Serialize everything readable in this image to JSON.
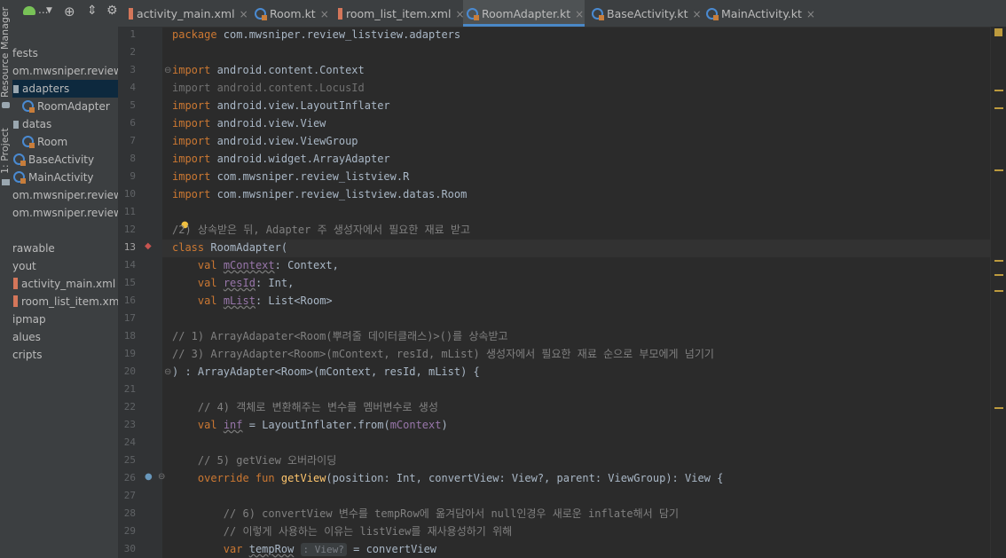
{
  "side_strip": {
    "resource_manager_label": "Resource Manager",
    "project_label": "1: Project"
  },
  "tree": [
    {
      "label": "fests",
      "indent": 0,
      "icon": "none"
    },
    {
      "label": "om.mwsniper.review_li",
      "indent": 0,
      "icon": "none"
    },
    {
      "label": "adapters",
      "indent": 1,
      "icon": "folder",
      "selected": true
    },
    {
      "label": "RoomAdapter",
      "indent": 2,
      "icon": "kotlin"
    },
    {
      "label": "datas",
      "indent": 1,
      "icon": "folder"
    },
    {
      "label": "Room",
      "indent": 2,
      "icon": "kotlin"
    },
    {
      "label": "BaseActivity",
      "indent": 1,
      "icon": "kotlin"
    },
    {
      "label": "MainActivity",
      "indent": 1,
      "icon": "kotlin"
    },
    {
      "label": "om.mwsniper.review_li",
      "indent": 0,
      "icon": "none"
    },
    {
      "label": "om.mwsniper.review_li",
      "indent": 0,
      "icon": "none"
    },
    {
      "label": "",
      "indent": 0,
      "icon": "none"
    },
    {
      "label": "rawable",
      "indent": 0,
      "icon": "none"
    },
    {
      "label": "yout",
      "indent": 0,
      "icon": "none"
    },
    {
      "label": "activity_main.xml",
      "indent": 1,
      "icon": "xml"
    },
    {
      "label": "room_list_item.xml",
      "indent": 1,
      "icon": "xml"
    },
    {
      "label": "ipmap",
      "indent": 0,
      "icon": "none"
    },
    {
      "label": "alues",
      "indent": 0,
      "icon": "none"
    },
    {
      "label": "cripts",
      "indent": 0,
      "icon": "none"
    }
  ],
  "tabs": [
    {
      "label": "activity_main.xml",
      "icon": "xml",
      "active": false
    },
    {
      "label": "Room.kt",
      "icon": "kotlin",
      "active": false
    },
    {
      "label": "room_list_item.xml",
      "icon": "xml",
      "active": false
    },
    {
      "label": "RoomAdapter.kt",
      "icon": "kotlin",
      "active": true
    },
    {
      "label": "BaseActivity.kt",
      "icon": "kotlin",
      "active": false
    },
    {
      "label": "MainActivity.kt",
      "icon": "kotlin",
      "active": false
    }
  ],
  "toolbar_dropdown_label": "...",
  "current_line": 13,
  "code_lines": [
    {
      "n": "1",
      "t": "package com.mwsniper.review_listview.adapters"
    },
    {
      "n": "2",
      "t": ""
    },
    {
      "n": "3",
      "t": "import android.content.Context"
    },
    {
      "n": "4",
      "t": "import android.content.LocusId"
    },
    {
      "n": "5",
      "t": "import android.view.LayoutInflater"
    },
    {
      "n": "6",
      "t": "import android.view.View"
    },
    {
      "n": "7",
      "t": "import android.view.ViewGroup"
    },
    {
      "n": "8",
      "t": "import android.widget.ArrayAdapter"
    },
    {
      "n": "9",
      "t": "import com.mwsniper.review_listview.R"
    },
    {
      "n": "10",
      "t": "import com.mwsniper.review_listview.datas.Room"
    },
    {
      "n": "11",
      "t": ""
    },
    {
      "n": "12",
      "t": "/2) 상속받은 뒤, Adapter 주 생성자에서 필요한 재료 받고"
    },
    {
      "n": "13",
      "t": "class RoomAdapter("
    },
    {
      "n": "14",
      "t": "    val mContext: Context,"
    },
    {
      "n": "15",
      "t": "    val resId: Int,"
    },
    {
      "n": "16",
      "t": "    val mList: List<Room>"
    },
    {
      "n": "17",
      "t": ""
    },
    {
      "n": "18",
      "t": "// 1) ArrayAdapater<Room(뿌려줄 데이터클래스)>()를 상속받고"
    },
    {
      "n": "19",
      "t": "// 3) ArrayAdapter<Room>(mContext, resId, mList) 생성자에서 필요한 재료 순으로 부모에게 넘기기"
    },
    {
      "n": "20",
      "t": ") : ArrayAdapter<Room>(mContext, resId, mList) {"
    },
    {
      "n": "21",
      "t": ""
    },
    {
      "n": "22",
      "t": "    // 4) 객체로 변환해주는 변수를 멤버변수로 생성"
    },
    {
      "n": "23",
      "t": "    val inf = LayoutInflater.from(mContext)"
    },
    {
      "n": "24",
      "t": ""
    },
    {
      "n": "25",
      "t": "    // 5) getView 오버라이딩"
    },
    {
      "n": "26",
      "t": "    override fun getView(position: Int, convertView: View?, parent: ViewGroup): View {"
    },
    {
      "n": "27",
      "t": ""
    },
    {
      "n": "28",
      "t": "        // 6) convertView 변수를 tempRow에 옮겨담아서 null인경우 새로운 inflate해서 담기"
    },
    {
      "n": "29",
      "t": "        // 이렇게 사용하는 이유는 listView를 재사용성하기 위해"
    },
    {
      "n": "30",
      "t": "        var tempRow : View? = convertView"
    }
  ],
  "colors": {
    "editor_bg": "#2b2b2b",
    "keyword": "#cc7832",
    "comment": "#808080",
    "function": "#ffc66d",
    "property": "#9876aa",
    "text": "#a9b7c6",
    "tab_underline": "#4a88c7",
    "selection": "#0d293e"
  }
}
